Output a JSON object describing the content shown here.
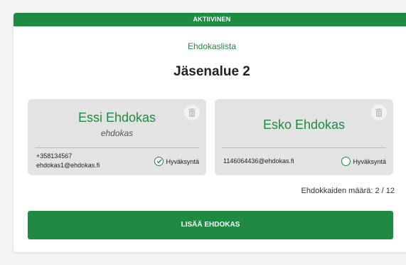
{
  "status": {
    "label": "AKTIIVINEN"
  },
  "header": {
    "list_label": "Ehdokaslista",
    "area_title": "Jäsenalue 2"
  },
  "candidates": [
    {
      "name": "Essi Ehdokas",
      "role": "ehdokas",
      "phone": "+358134567",
      "email": "ehdokas1@ehdokas.fi",
      "approval_label": "Hyväksyntä",
      "approved": true,
      "delete_icon": "trash-icon"
    },
    {
      "name": "Esko Ehdokas",
      "role": "",
      "phone": "",
      "email": "1146064436@ehdokas.fi",
      "approval_label": "Hyväksyntä",
      "approved": false,
      "delete_icon": "trash-icon"
    }
  ],
  "footer": {
    "count_text": "Ehdokkaiden määrä: 2 / 12",
    "add_button_label": "LISÄÄ EHDOKAS"
  },
  "colors": {
    "accent": "#1f8a42",
    "card_bg": "#e3e3e3",
    "page_bg": "#f3f3f3"
  }
}
